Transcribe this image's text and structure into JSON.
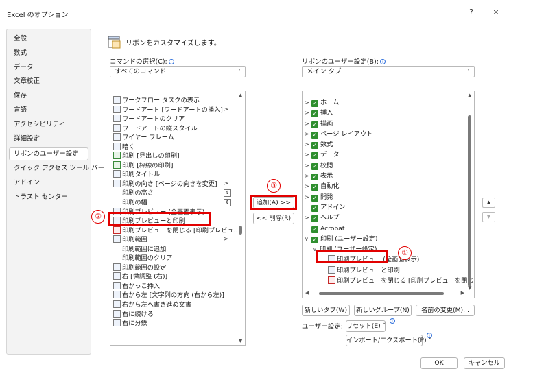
{
  "window": {
    "title": "Excel のオプション",
    "help": "?",
    "close": "×"
  },
  "sidebar": {
    "items": [
      {
        "label": "全般",
        "active": false
      },
      {
        "label": "数式",
        "active": false
      },
      {
        "label": "データ",
        "active": false
      },
      {
        "label": "文章校正",
        "active": false
      },
      {
        "label": "保存",
        "active": false
      },
      {
        "label": "言語",
        "active": false
      },
      {
        "label": "アクセシビリティ",
        "active": false
      },
      {
        "label": "詳細設定",
        "active": false
      },
      {
        "label": "リボンのユーザー設定",
        "active": true
      },
      {
        "label": "クイック アクセス ツール バー",
        "active": false
      },
      {
        "label": "アドイン",
        "active": false
      },
      {
        "label": "トラスト センター",
        "active": false
      }
    ]
  },
  "header": {
    "text": "リボンをカスタマイズします。"
  },
  "left": {
    "label": "コマンドの選択(C):",
    "select_value": "すべてのコマンド",
    "commands": [
      {
        "label": "ワークフロー タスクの表示",
        "icon": "workflow-icon",
        "sub": false
      },
      {
        "label": "ワードアート [ワードアートの挿入]",
        "icon": "wordart-icon",
        "sub": true
      },
      {
        "label": "ワードアートのクリア",
        "icon": "wordart-clear-icon",
        "sub": false
      },
      {
        "label": "ワードアートの縦スタイル",
        "icon": "wordart-vertical-icon",
        "sub": false
      },
      {
        "label": "ワイヤー フレーム",
        "icon": "wireframe-icon",
        "sub": false
      },
      {
        "label": "暗く",
        "icon": "darken-icon",
        "sub": false
      },
      {
        "label": "印刷 [見出しの印刷]",
        "icon": "check-icon",
        "sub": false
      },
      {
        "label": "印刷 [枠線の印刷]",
        "icon": "check-icon",
        "sub": false
      },
      {
        "label": "印刷タイトル",
        "icon": "print-title-icon",
        "sub": false
      },
      {
        "label": "印刷の向き [ページの向きを変更]",
        "icon": "orientation-icon",
        "sub": true
      },
      {
        "label": "印刷の高さ",
        "icon": "none",
        "sub": false
      },
      {
        "label": "印刷の幅",
        "icon": "none",
        "sub": false
      },
      {
        "label": "印刷プレビュー (全画面表示)",
        "icon": "print-preview-icon",
        "sub": false
      },
      {
        "label": "印刷プレビューと印刷",
        "icon": "print-preview-print-icon",
        "sub": false
      },
      {
        "label": "印刷プレビューを閉じる [印刷プレビュ…",
        "icon": "close-preview-icon",
        "sub": false
      },
      {
        "label": "印刷範囲",
        "icon": "print-area-icon",
        "sub": true
      },
      {
        "label": "印刷範囲に追加",
        "icon": "none",
        "sub": false
      },
      {
        "label": "印刷範囲のクリア",
        "icon": "none",
        "sub": false
      },
      {
        "label": "印刷範囲の設定",
        "icon": "print-area-set-icon",
        "sub": false
      },
      {
        "label": "右 [微調整 (右)]",
        "icon": "nudge-right-icon",
        "sub": false
      },
      {
        "label": "右かっこ挿入",
        "icon": "paren-icon",
        "sub": false
      },
      {
        "label": "右から左 [文字列の方向 (右から左)]",
        "icon": "rtl-icon",
        "sub": false
      },
      {
        "label": "右から左へ書き進め文書",
        "icon": "rtl-doc-icon",
        "sub": false
      },
      {
        "label": "右に続ける",
        "icon": "continue-right-icon",
        "sub": false
      },
      {
        "label": "右に分鉄",
        "icon": "split-right-icon",
        "sub": false
      }
    ]
  },
  "middle": {
    "add_label": "追加(A) >>",
    "remove_label": "<< 削除(R)"
  },
  "right": {
    "label": "リボンのユーザー設定(B):",
    "select_value": "メイン タブ",
    "tabs": [
      {
        "label": "ホーム",
        "level": 0,
        "expander": ">",
        "checked": true
      },
      {
        "label": "挿入",
        "level": 0,
        "expander": ">",
        "checked": true
      },
      {
        "label": "描画",
        "level": 0,
        "expander": ">",
        "checked": true
      },
      {
        "label": "ページ レイアウト",
        "level": 0,
        "expander": ">",
        "checked": true
      },
      {
        "label": "数式",
        "level": 0,
        "expander": ">",
        "checked": true
      },
      {
        "label": "データ",
        "level": 0,
        "expander": ">",
        "checked": true
      },
      {
        "label": "校閲",
        "level": 0,
        "expander": ">",
        "checked": true
      },
      {
        "label": "表示",
        "level": 0,
        "expander": ">",
        "checked": true
      },
      {
        "label": "自動化",
        "level": 0,
        "expander": ">",
        "checked": true
      },
      {
        "label": "開発",
        "level": 0,
        "expander": ">",
        "checked": true
      },
      {
        "label": "アドイン",
        "level": 0,
        "expander": "",
        "checked": true
      },
      {
        "label": "ヘルプ",
        "level": 0,
        "expander": ">",
        "checked": true
      },
      {
        "label": "Acrobat",
        "level": 0,
        "expander": "",
        "checked": true
      },
      {
        "label": "印刷 (ユーザー設定)",
        "level": 0,
        "expander": "∨",
        "checked": true
      },
      {
        "label": "印刷 (ユーザー設定)",
        "level": 1,
        "expander": "∨",
        "checked": false
      },
      {
        "label": "印刷プレビュー (全画面表示)",
        "level": 2,
        "expander": "",
        "checked": false
      },
      {
        "label": "印刷プレビューと印刷",
        "level": 2,
        "expander": "",
        "checked": false
      },
      {
        "label": "印刷プレビューを閉じる [印刷プレビューを閉じる]",
        "level": 2,
        "expander": "",
        "checked": false
      }
    ],
    "new_tab": "新しいタブ(W)",
    "new_group": "新しいグループ(N)",
    "rename": "名前の変更(M)...",
    "customize_label": "ユーザー設定:",
    "reset": "リセット(E) ˅",
    "import_export": "インポート/エクスポート(P) ˅"
  },
  "footer": {
    "ok": "OK",
    "cancel": "キャンセル"
  },
  "annotations": {
    "one": "①",
    "two": "②",
    "three": "③"
  },
  "colors": {
    "highlight": "#e20000",
    "check": "#2f8f2f"
  }
}
